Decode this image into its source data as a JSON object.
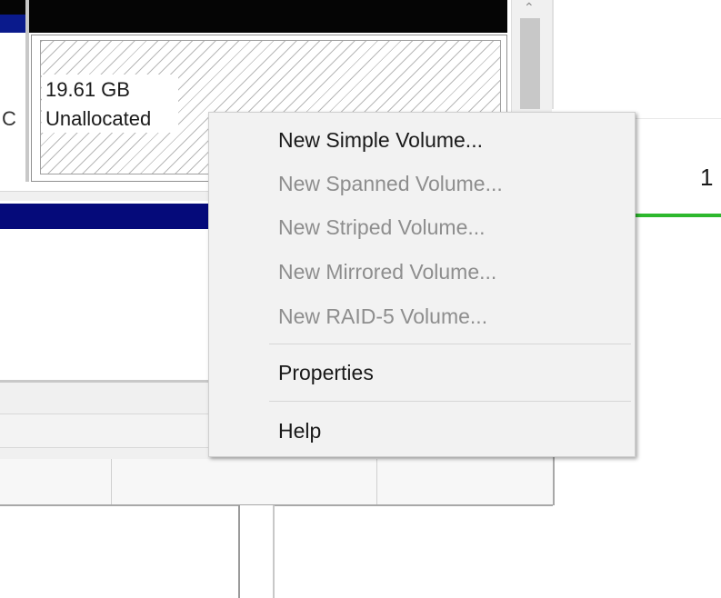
{
  "partition": {
    "size": "19.61 GB",
    "status": "Unallocated"
  },
  "left_partial_letter": "C",
  "right_partial_number": "1",
  "context_menu": {
    "items": [
      {
        "label": "New Simple Volume...",
        "enabled": true
      },
      {
        "label": "New Spanned Volume...",
        "enabled": false
      },
      {
        "label": "New Striped Volume...",
        "enabled": false
      },
      {
        "label": "New Mirrored Volume...",
        "enabled": false
      },
      {
        "label": "New RAID-5 Volume...",
        "enabled": false
      },
      {
        "label": "Properties",
        "enabled": true
      },
      {
        "label": "Help",
        "enabled": true
      }
    ]
  },
  "colors": {
    "disk_header": "#050505",
    "primary_bar": "#050a7a",
    "healthy_line": "#2db82d",
    "menu_background": "#f2f2f2",
    "disabled_text": "#8e8e8e"
  }
}
